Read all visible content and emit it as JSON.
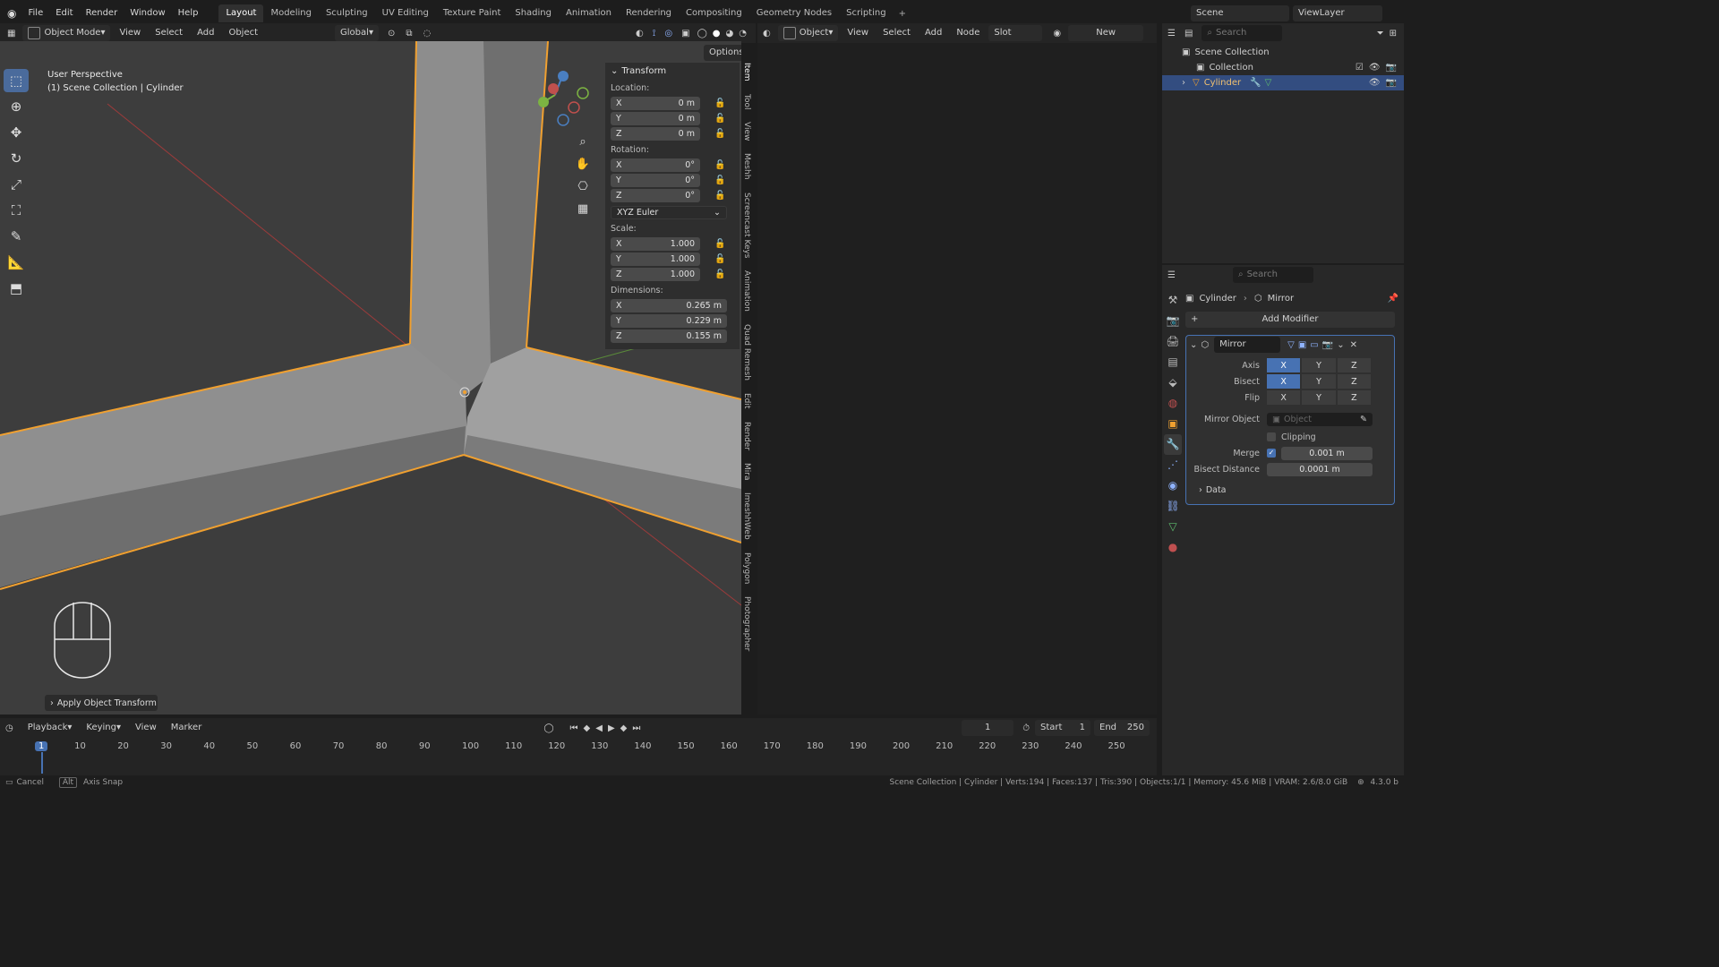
{
  "topbar": {
    "menus": [
      "File",
      "Edit",
      "Render",
      "Window",
      "Help"
    ],
    "workspaces": [
      "Layout",
      "Modeling",
      "Sculpting",
      "UV Editing",
      "Texture Paint",
      "Shading",
      "Animation",
      "Rendering",
      "Compositing",
      "Geometry Nodes",
      "Scripting"
    ],
    "scene": "Scene",
    "view_layer": "ViewLayer"
  },
  "viewport_header": {
    "mode": "Object Mode",
    "menus": [
      "View",
      "Select",
      "Add",
      "Object"
    ],
    "orientation": "Global",
    "options": "Options"
  },
  "viewport": {
    "title": "User Perspective",
    "subtitle": "(1) Scene Collection | Cylinder",
    "last_op": "Apply Object Transform"
  },
  "transform": {
    "header": "Transform",
    "location_label": "Location:",
    "location": {
      "x": "0 m",
      "y": "0 m",
      "z": "0 m"
    },
    "rotation_label": "Rotation:",
    "rotation": {
      "x": "0°",
      "y": "0°",
      "z": "0°"
    },
    "rotation_mode": "XYZ Euler",
    "scale_label": "Scale:",
    "scale": {
      "x": "1.000",
      "y": "1.000",
      "z": "1.000"
    },
    "dimensions_label": "Dimensions:",
    "dimensions": {
      "x": "0.265 m",
      "y": "0.229 m",
      "z": "0.155 m"
    },
    "axis": {
      "x": "X",
      "y": "Y",
      "z": "Z"
    }
  },
  "side_tabs": [
    "Item",
    "Tool",
    "View",
    "Meshh",
    "Screencast Keys",
    "Animation",
    "Quad Remesh",
    "Edit",
    "Render",
    "Mira",
    "ImeshhWeb",
    "Polygon",
    "Photographer"
  ],
  "node_header": {
    "type": "Object",
    "menus": [
      "View",
      "Select",
      "Add",
      "Node"
    ],
    "slot": "Slot",
    "new": "New"
  },
  "outliner": {
    "search_placeholder": "Search",
    "root": "Scene Collection",
    "collection": "Collection",
    "object": "Cylinder"
  },
  "properties": {
    "search_placeholder": "Search",
    "breadcrumb_object": "Cylinder",
    "breadcrumb_modifier": "Mirror",
    "add_modifier": "Add Modifier",
    "modifier_name": "Mirror",
    "axis_label": "Axis",
    "bisect_label": "Bisect",
    "flip_label": "Flip",
    "mirror_object_label": "Mirror Object",
    "mirror_object_placeholder": "Object",
    "clipping_label": "Clipping",
    "merge_label": "Merge",
    "merge_value": "0.001 m",
    "bisect_distance_label": "Bisect Distance",
    "bisect_distance_value": "0.0001 m",
    "data_label": "Data",
    "x": "X",
    "y": "Y",
    "z": "Z"
  },
  "timeline": {
    "menus": [
      "Playback",
      "Keying",
      "View",
      "Marker"
    ],
    "current_frame": "1",
    "start_label": "Start",
    "start": "1",
    "end_label": "End",
    "end": "250",
    "ticks": [
      "1",
      "10",
      "20",
      "30",
      "40",
      "50",
      "60",
      "70",
      "80",
      "90",
      "100",
      "110",
      "120",
      "130",
      "140",
      "150",
      "160",
      "170",
      "180",
      "190",
      "200",
      "210",
      "220",
      "230",
      "240",
      "250"
    ]
  },
  "statusbar": {
    "left_cancel": "Cancel",
    "left_alt": "Alt",
    "left_axis_snap": "Axis Snap",
    "stats": "Scene Collection | Cylinder | Verts:194 | Faces:137 | Tris:390 | Objects:1/1 | Memory: 45.6 MiB | VRAM: 2.6/8.0 GiB",
    "version": "4.3.0 b"
  },
  "colors": {
    "accent": "#4772b3",
    "selection_outline": "#f0a030",
    "viewport_bg": "#3d3d3d"
  }
}
